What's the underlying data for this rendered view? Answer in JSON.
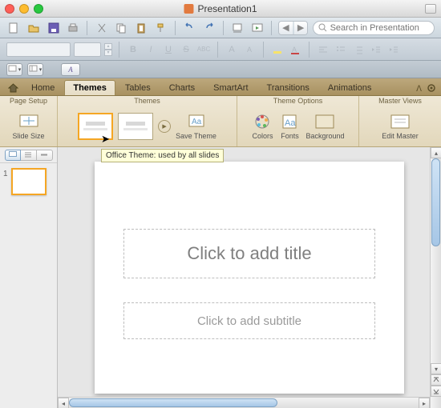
{
  "window": {
    "title": "Presentation1"
  },
  "search": {
    "placeholder": "Search in Presentation"
  },
  "format": {
    "bold": "B",
    "italic": "I",
    "underline": "U",
    "strike": "S",
    "abc": "ABC",
    "a_up": "A",
    "a_dn": "A"
  },
  "tabs": {
    "home": "Home",
    "themes": "Themes",
    "tables": "Tables",
    "charts": "Charts",
    "smartart": "SmartArt",
    "transitions": "Transitions",
    "animations": "Animations"
  },
  "ribbon": {
    "page_setup": {
      "label": "Page Setup",
      "slide_size": "Slide Size"
    },
    "themes": {
      "label": "Themes",
      "save_theme": "Save Theme"
    },
    "theme_options": {
      "label": "Theme Options",
      "colors": "Colors",
      "fonts": "Fonts",
      "background": "Background"
    },
    "master_views": {
      "label": "Master Views",
      "edit_master": "Edit Master"
    }
  },
  "tooltip": "Office Theme: used by all slides",
  "sidebar": {
    "slide_number": "1"
  },
  "slide": {
    "title_placeholder": "Click to add title",
    "subtitle_placeholder": "Click to add subtitle"
  }
}
